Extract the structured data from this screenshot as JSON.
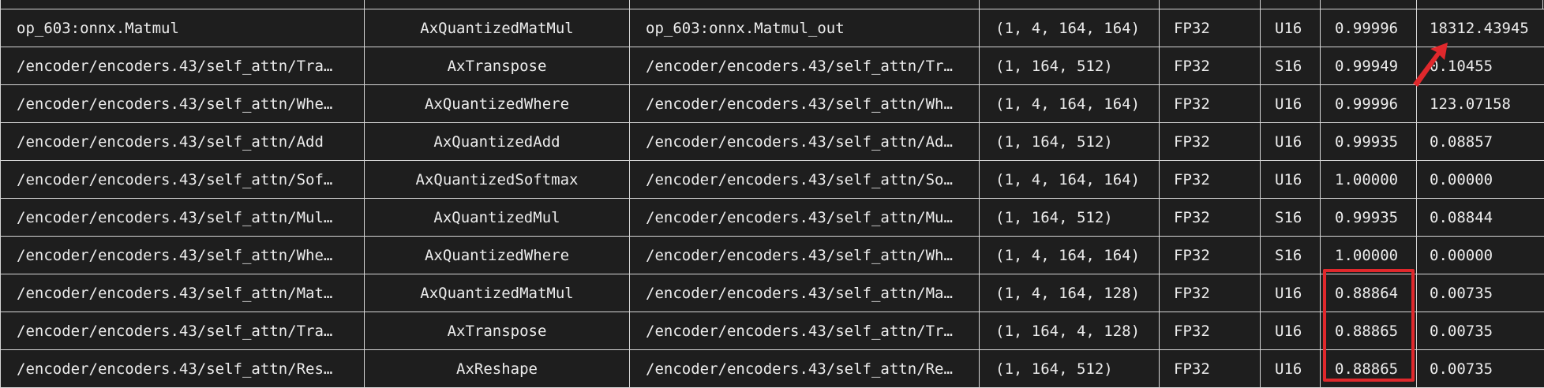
{
  "table": {
    "rows": [
      [
        "op_603:onnx.Matmul",
        "AxQuantizedMatMul",
        "op_603:onnx.Matmul_out",
        "(1, 4, 164, 164)",
        "FP32",
        "U16",
        "0.99996",
        "18312.43945"
      ],
      [
        "/encoder/encoders.43/self_attn/Tra…",
        "AxTranspose",
        "/encoder/encoders.43/self_attn/Tr…",
        "(1, 164, 512)",
        "FP32",
        "S16",
        "0.99949",
        "0.10455"
      ],
      [
        "/encoder/encoders.43/self_attn/Whe…",
        "AxQuantizedWhere",
        "/encoder/encoders.43/self_attn/Wh…",
        "(1, 4, 164, 164)",
        "FP32",
        "U16",
        "0.99996",
        "123.07158"
      ],
      [
        "/encoder/encoders.43/self_attn/Add",
        "AxQuantizedAdd",
        "/encoder/encoders.43/self_attn/Ad…",
        "(1, 164, 512)",
        "FP32",
        "U16",
        "0.99935",
        "0.08857"
      ],
      [
        "/encoder/encoders.43/self_attn/Sof…",
        "AxQuantizedSoftmax",
        "/encoder/encoders.43/self_attn/So…",
        "(1, 4, 164, 164)",
        "FP32",
        "U16",
        "1.00000",
        "0.00000"
      ],
      [
        "/encoder/encoders.43/self_attn/Mul…",
        "AxQuantizedMul",
        "/encoder/encoders.43/self_attn/Mu…",
        "(1, 164, 512)",
        "FP32",
        "S16",
        "0.99935",
        "0.08844"
      ],
      [
        "/encoder/encoders.43/self_attn/Whe…",
        "AxQuantizedWhere",
        "/encoder/encoders.43/self_attn/Wh…",
        "(1, 4, 164, 164)",
        "FP32",
        "S16",
        "1.00000",
        "0.00000"
      ],
      [
        "/encoder/encoders.43/self_attn/Mat…",
        "AxQuantizedMatMul",
        "/encoder/encoders.43/self_attn/Ma…",
        "(1, 4, 164, 128)",
        "FP32",
        "U16",
        "0.88864",
        "0.00735"
      ],
      [
        "/encoder/encoders.43/self_attn/Tra…",
        "AxTranspose",
        "/encoder/encoders.43/self_attn/Tr…",
        "(1, 164, 4, 128)",
        "FP32",
        "U16",
        "0.88865",
        "0.00735"
      ],
      [
        "/encoder/encoders.43/self_attn/Res…",
        "AxReshape",
        "/encoder/encoders.43/self_attn/Re…",
        "(1, 164, 512)",
        "FP32",
        "U16",
        "0.88865",
        "0.00735"
      ]
    ]
  },
  "annotations": {
    "highlight_color": "#e0282c",
    "arrow_icon": "red-arrow-icon"
  },
  "colors": {
    "background": "#1e1e1e",
    "grid_line": "#d6d6d6",
    "text": "#ececec"
  }
}
